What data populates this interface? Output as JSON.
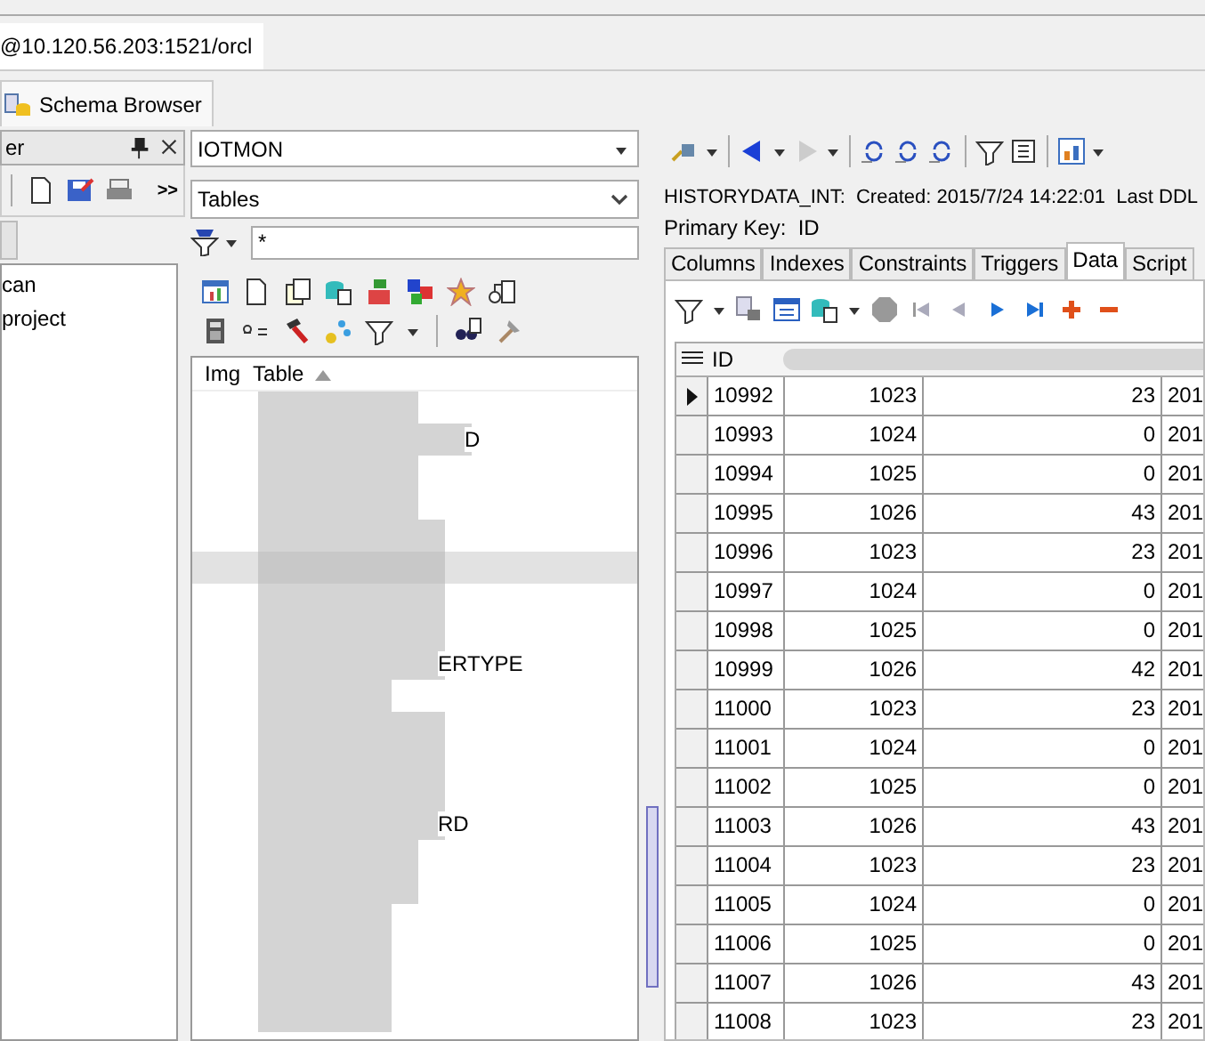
{
  "connection_tab": {
    "label": "@10.120.56.203:1521/orcl"
  },
  "document_tab": {
    "label": "Schema Browser"
  },
  "project_panel": {
    "title": "er",
    "overflow": ">>",
    "items": [
      {
        "label": "can"
      },
      {
        "label": "project"
      }
    ]
  },
  "object_browser": {
    "schema": "IOTMON",
    "object_type": "Tables",
    "filter": "*",
    "columns": [
      "Img",
      "Table"
    ],
    "rows": [
      {
        "selected": false
      },
      {
        "selected": false,
        "text": "D"
      },
      {
        "selected": false
      },
      {
        "selected": false
      },
      {
        "selected": false
      },
      {
        "selected": true
      },
      {
        "selected": false
      },
      {
        "selected": false
      },
      {
        "selected": false,
        "text": "ERTYPE"
      },
      {
        "selected": false
      },
      {
        "selected": false
      },
      {
        "selected": false
      },
      {
        "selected": false
      },
      {
        "selected": false,
        "text": "RD"
      },
      {
        "selected": false
      },
      {
        "selected": false
      },
      {
        "selected": false
      },
      {
        "selected": false
      },
      {
        "selected": false
      },
      {
        "selected": false
      }
    ]
  },
  "details": {
    "info": "HISTORYDATA_INT:  Created: 2015/7/24 14:22:01  Last DDL",
    "primary_key": "Primary Key:  ID",
    "tabs": [
      {
        "label": "Columns",
        "selected": false
      },
      {
        "label": "Indexes",
        "selected": false
      },
      {
        "label": "Constraints",
        "selected": false
      },
      {
        "label": "Triggers",
        "selected": false
      },
      {
        "label": "Data",
        "selected": true
      },
      {
        "label": "Script",
        "selected": false
      }
    ],
    "grid": {
      "columns": [
        "ID"
      ],
      "rows": [
        {
          "current": true,
          "cells": [
            "10992",
            "1023",
            "23",
            "201"
          ]
        },
        {
          "current": false,
          "cells": [
            "10993",
            "1024",
            "0",
            "201"
          ]
        },
        {
          "current": false,
          "cells": [
            "10994",
            "1025",
            "0",
            "201"
          ]
        },
        {
          "current": false,
          "cells": [
            "10995",
            "1026",
            "43",
            "201"
          ]
        },
        {
          "current": false,
          "cells": [
            "10996",
            "1023",
            "23",
            "201"
          ]
        },
        {
          "current": false,
          "cells": [
            "10997",
            "1024",
            "0",
            "201"
          ]
        },
        {
          "current": false,
          "cells": [
            "10998",
            "1025",
            "0",
            "201"
          ]
        },
        {
          "current": false,
          "cells": [
            "10999",
            "1026",
            "42",
            "201"
          ]
        },
        {
          "current": false,
          "cells": [
            "11000",
            "1023",
            "23",
            "201"
          ]
        },
        {
          "current": false,
          "cells": [
            "11001",
            "1024",
            "0",
            "201"
          ]
        },
        {
          "current": false,
          "cells": [
            "11002",
            "1025",
            "0",
            "201"
          ]
        },
        {
          "current": false,
          "cells": [
            "11003",
            "1026",
            "43",
            "201"
          ]
        },
        {
          "current": false,
          "cells": [
            "11004",
            "1023",
            "23",
            "201"
          ]
        },
        {
          "current": false,
          "cells": [
            "11005",
            "1024",
            "0",
            "201"
          ]
        },
        {
          "current": false,
          "cells": [
            "11006",
            "1025",
            "0",
            "201"
          ]
        },
        {
          "current": false,
          "cells": [
            "11007",
            "1026",
            "43",
            "201"
          ]
        },
        {
          "current": false,
          "cells": [
            "11008",
            "1023",
            "23",
            "201"
          ]
        }
      ]
    }
  }
}
